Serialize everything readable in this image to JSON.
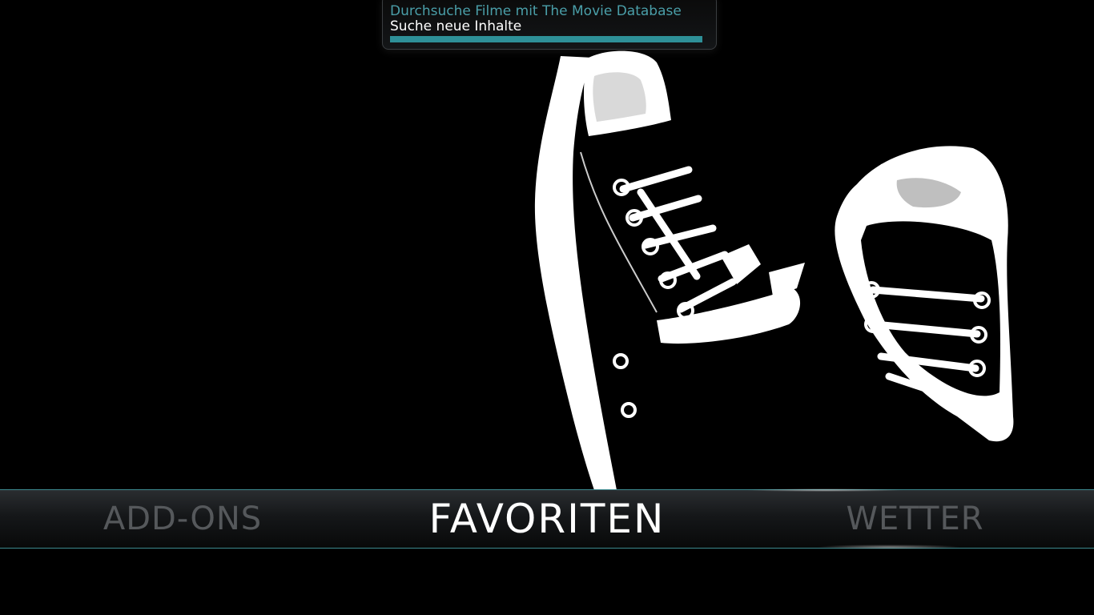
{
  "notification": {
    "heading": "Durchsuche Filme mit The Movie Database",
    "message": "Suche neue Inhalte",
    "progress_percent": 100,
    "colors": {
      "heading": "#4a9ea8",
      "progress": "#2e9098"
    }
  },
  "home_menu": {
    "items": [
      {
        "label": "ADD-ONS",
        "state": "unfocused"
      },
      {
        "label": "FAVORITEN",
        "state": "focused"
      },
      {
        "label": "WETTER",
        "state": "unfocused"
      }
    ],
    "accent_color": "#3d8a8f"
  },
  "background": {
    "image": "sneakers-black-and-white-icon"
  }
}
